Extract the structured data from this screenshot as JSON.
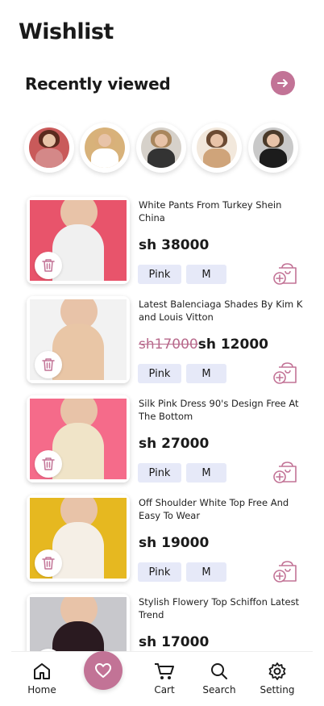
{
  "header": {
    "title": "Wishlist"
  },
  "recent": {
    "title": "Recently viewed",
    "stories": [
      {
        "hair": "#5a2a1e",
        "body": "#d48888",
        "bg": "#c95a5a"
      },
      {
        "hair": "#d9b07a",
        "body": "#ffffff",
        "bg": "#d8b27a"
      },
      {
        "hair": "#a9865d",
        "body": "#333333",
        "bg": "#d6d1ca"
      },
      {
        "hair": "#6b4a32",
        "body": "#cfa47a",
        "bg": "#f2e8dc"
      },
      {
        "hair": "#4a3a2a",
        "body": "#1c1c1c",
        "bg": "#c9c9c9"
      }
    ]
  },
  "items": [
    {
      "name": "White Pants From Turkey Shein China",
      "old_price": "",
      "price": "sh 38000",
      "color": "Pink",
      "size": "M",
      "bg": "#e8546b",
      "accent": "#f0f0f0"
    },
    {
      "name": "Latest Balenciaga Shades By Kim K and Louis Vitton",
      "old_price": "sh17000",
      "price": "sh 12000",
      "color": "Pink",
      "size": "M",
      "bg": "#f2f2f2",
      "accent": "#e9c6a6"
    },
    {
      "name": "Silk Pink Dress 90's Design Free At The Bottom",
      "old_price": "",
      "price": "sh 27000",
      "color": "Pink",
      "size": "M",
      "bg": "#f56b8a",
      "accent": "#f0e4c8"
    },
    {
      "name": "Off Shoulder White Top Free And Easy To Wear",
      "old_price": "",
      "price": "sh 19000",
      "color": "Pink",
      "size": "M",
      "bg": "#e6b820",
      "accent": "#f5efe6"
    },
    {
      "name": "Stylish Flowery Top Schiffon Latest Trend",
      "old_price": "",
      "price": "sh 17000",
      "color": "Pink",
      "size": "M",
      "bg": "#c8c8cc",
      "accent": "#2a1a20"
    }
  ],
  "tabs": {
    "home": "Home",
    "cart": "Cart",
    "search": "Search",
    "setting": "Setting"
  },
  "colors": {
    "accent": "#c27396",
    "chip": "#e6e9f8"
  }
}
